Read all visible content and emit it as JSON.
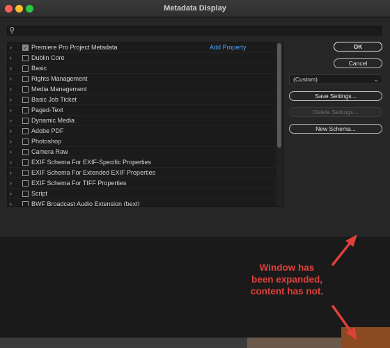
{
  "window": {
    "title": "Metadata Display"
  },
  "tree": {
    "add_property": "Add Property",
    "items": [
      {
        "label": "Premiere Pro Project Metadata",
        "checked": true
      },
      {
        "label": "Dublin Core",
        "checked": false
      },
      {
        "label": "Basic",
        "checked": false
      },
      {
        "label": "Rights Management",
        "checked": false
      },
      {
        "label": "Media Management",
        "checked": false
      },
      {
        "label": "Basic Job Ticket",
        "checked": false
      },
      {
        "label": "Paged-Text",
        "checked": false
      },
      {
        "label": "Dynamic Media",
        "checked": false
      },
      {
        "label": "Adobe PDF",
        "checked": false
      },
      {
        "label": "Photoshop",
        "checked": false
      },
      {
        "label": "Camera Raw",
        "checked": false
      },
      {
        "label": "EXIF Schema For EXIF-Specific Properties",
        "checked": false
      },
      {
        "label": "EXIF Schema For Extended EXIF Properties",
        "checked": false
      },
      {
        "label": "EXIF Schema For TIFF Properties",
        "checked": false
      },
      {
        "label": "Script",
        "checked": false
      },
      {
        "label": "BWF Broadcast Audio Extension (bext)",
        "checked": false
      }
    ]
  },
  "buttons": {
    "ok": "OK",
    "cancel": "Cancel",
    "save_settings": "Save Settings...",
    "delete_settings": "Delete Settings...",
    "new_schema": "New Schema..."
  },
  "preset": {
    "selected": "(Custom)"
  },
  "annotation": {
    "lines": [
      "Window has",
      "been expanded,",
      "content has not."
    ]
  },
  "colors": {
    "annotation": "#e0403a",
    "link": "#4aa3ff"
  }
}
